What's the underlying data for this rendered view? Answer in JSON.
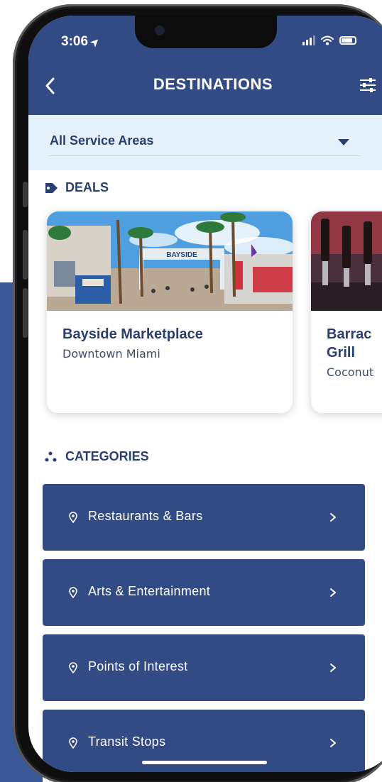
{
  "status_bar": {
    "time": "3:06"
  },
  "header": {
    "title": "DESTINATIONS"
  },
  "service_area": {
    "selected": "All Service Areas"
  },
  "deals": {
    "heading": "DEALS",
    "cards": [
      {
        "name": "Bayside Marketplace",
        "location": "Downtown Miami",
        "sign": "BAYSIDE"
      },
      {
        "name": "Barrac Grill",
        "location": "Coconut"
      }
    ]
  },
  "categories": {
    "heading": "CATEGORIES",
    "items": [
      {
        "label": "Restaurants & Bars"
      },
      {
        "label": "Arts & Entertainment"
      },
      {
        "label": "Points of Interest"
      },
      {
        "label": "Transit Stops"
      }
    ]
  },
  "colors": {
    "primary": "#334b85",
    "light_bar": "#e4f0fa",
    "text_dark": "#2a3f6f"
  },
  "icons": [
    "location-arrow-icon",
    "signal-icon",
    "wifi-icon",
    "battery-icon",
    "back-chevron-icon",
    "filter-sliders-icon",
    "chevron-down-icon",
    "tag-icon",
    "dots-icon",
    "map-pin-icon",
    "chevron-right-icon"
  ]
}
